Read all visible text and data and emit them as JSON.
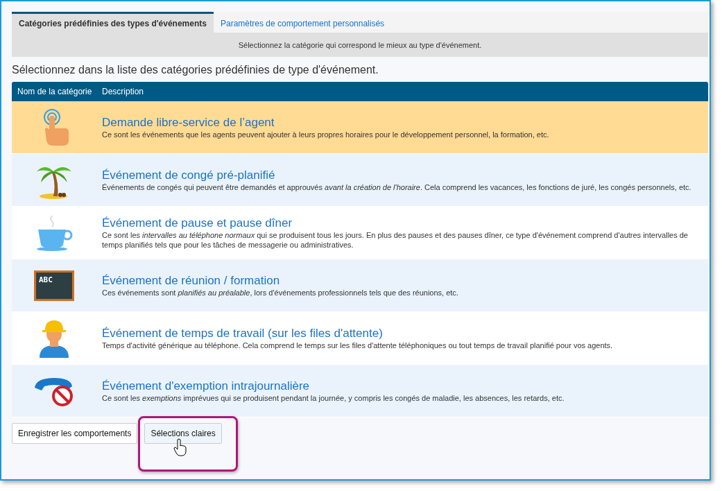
{
  "tabs": [
    {
      "label": "Catégories prédéfinies des types d'événements",
      "selected": true
    },
    {
      "label": "Paramètres de comportement personnalisés",
      "selected": false
    }
  ],
  "hint": "Sélectionnez la catégorie qui correspond le mieux au type d'événement.",
  "heading": "Sélectionnez dans la liste des catégories prédéfinies de type d'événement.",
  "table": {
    "columns": [
      "Nom de la catégorie",
      "Description"
    ],
    "rows": [
      {
        "kind": "touch",
        "selected": true,
        "title": "Demande libre-service de l’agent",
        "description": "Ce sont les événements que les agents peuvent ajouter à leurs propres horaires pour le développement personnel, la formation, etc."
      },
      {
        "kind": "palm",
        "selected": false,
        "title": "Événement de congé pré-planifié",
        "description": "Événements de congés qui peuvent être demandés et approuvés *avant la création de l'horaire*. Cela comprend les vacances, les fonctions de juré, les congés personnels, etc."
      },
      {
        "kind": "cup",
        "selected": false,
        "title": "Événement de pause et pause dîner",
        "description": "Ce sont les *intervalles au téléphone normaux* qui se produisent tous les jours. En plus des pauses et des pauses dîner, ce type d'événement comprend d'autres intervalles de temps planifiés tels que pour les tâches de messagerie ou administratives."
      },
      {
        "kind": "chalkboard",
        "icon_text": "ABC",
        "selected": false,
        "title": "Événement de réunion / formation",
        "description": "Ces événements sont *planifiés au préalable*, lors d'événements professionnels tels que des réunions, etc."
      },
      {
        "kind": "worker",
        "selected": false,
        "title": "Événement de temps de travail (sur les files d'attente)",
        "description": "Temps d'activité générique au téléphone. Cela comprend le temps sur les files d'attente téléphoniques ou tout temps de travail planifié pour vos agents."
      },
      {
        "kind": "phone",
        "selected": false,
        "title": "Événement d'exemption intrajournalière",
        "description": "Ce sont les *exemptions* imprévues qui se produisent pendant la journée, y compris les congés de maladie, les absences, les retards, etc."
      }
    ]
  },
  "buttons": [
    {
      "label": "Enregistrer les comportements",
      "hovered": false
    },
    {
      "label": "Sélections claires",
      "hovered": true
    }
  ]
}
